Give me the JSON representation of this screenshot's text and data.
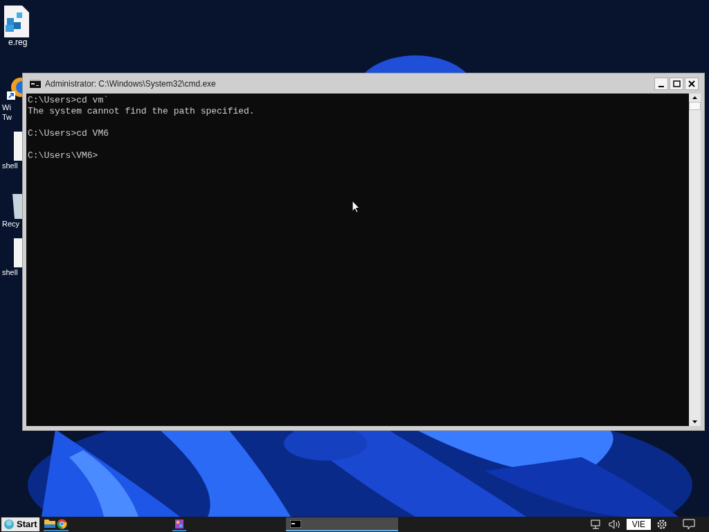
{
  "desktop_icons": [
    {
      "kind": "reg",
      "label_lines": [
        "e.reg"
      ]
    },
    {
      "kind": "shortcut",
      "label_lines": [
        "Wi",
        "Tw"
      ]
    },
    {
      "kind": "file",
      "label_lines": [
        "shell"
      ]
    },
    {
      "kind": "recycle",
      "label_lines": [
        "Recy"
      ]
    },
    {
      "kind": "file",
      "label_lines": [
        "shell"
      ]
    }
  ],
  "window": {
    "title": "Administrator: C:\\Windows\\System32\\cmd.exe",
    "output_blocks": [
      [
        "C:\\Users>cd vm`",
        "The system cannot find the path specified."
      ],
      [
        "C:\\Users>cd VM6"
      ],
      [
        "C:\\Users\\VM6>"
      ]
    ]
  },
  "taskbar": {
    "start_label": "Start",
    "apps": [
      {
        "kind": "folder",
        "selected": false
      },
      {
        "kind": "browser",
        "selected": false
      },
      {
        "kind": "app",
        "selected": false
      },
      {
        "kind": "console",
        "selected": true
      }
    ],
    "language": "VIE"
  }
}
